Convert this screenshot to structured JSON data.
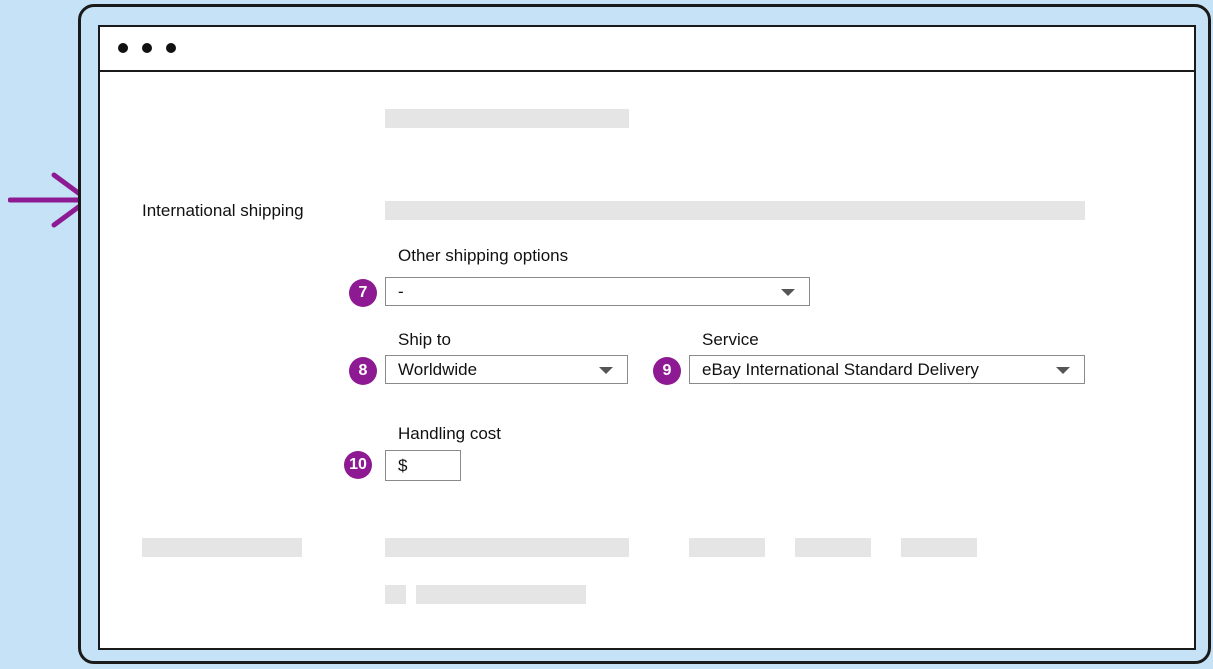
{
  "section": {
    "label": "International shipping"
  },
  "fields": {
    "other_options": {
      "badge": "7",
      "label": "Other shipping options",
      "value": "-"
    },
    "ship_to": {
      "badge": "8",
      "label": "Ship to",
      "value": "Worldwide"
    },
    "service": {
      "badge": "9",
      "label": "Service",
      "value": "eBay International Standard Delivery"
    },
    "handling_cost": {
      "badge": "10",
      "label": "Handling cost",
      "currency": "$"
    }
  },
  "colors": {
    "accent": "#8d1a93",
    "background": "#c5e2f7",
    "placeholder": "#e5e5e5"
  },
  "icons": {
    "pointer": "arrow-right-icon",
    "dropdown": "chevron-down-icon"
  }
}
